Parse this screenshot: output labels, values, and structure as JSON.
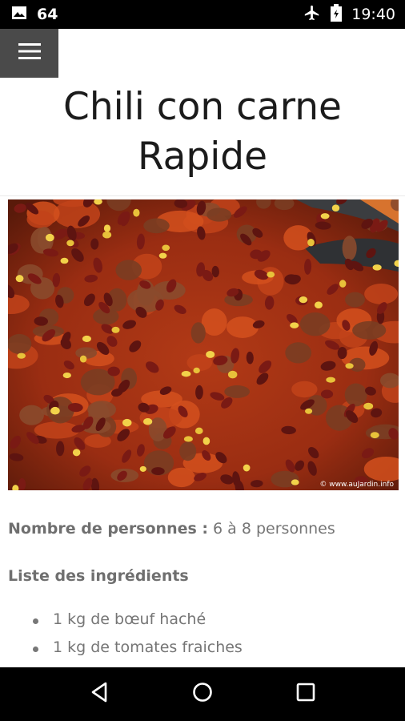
{
  "status_bar": {
    "notification_number": "64",
    "time": "19:40"
  },
  "icons": {
    "image": "image-icon",
    "airplane": "airplane-icon",
    "battery": "battery-icon",
    "menu": "hamburger-menu-icon",
    "back": "back-icon",
    "home": "home-icon",
    "recents": "recents-icon"
  },
  "recipe": {
    "title_line1": "Chili con carne",
    "title_line2": "Rapide",
    "photo_credit": "© www.auJardin.info",
    "servings_label": "Nombre de personnes :",
    "servings_value": " 6 à 8 personnes",
    "ingredients_heading": "Liste des ingrédients",
    "ingredients": [
      "1 kg de bœuf haché",
      "1 kg de tomates fraiches"
    ]
  },
  "colors": {
    "status_bar": "#000000",
    "menu_button": "#4a4a4a",
    "title": "#1b1b1b",
    "body_text": "#757575"
  }
}
